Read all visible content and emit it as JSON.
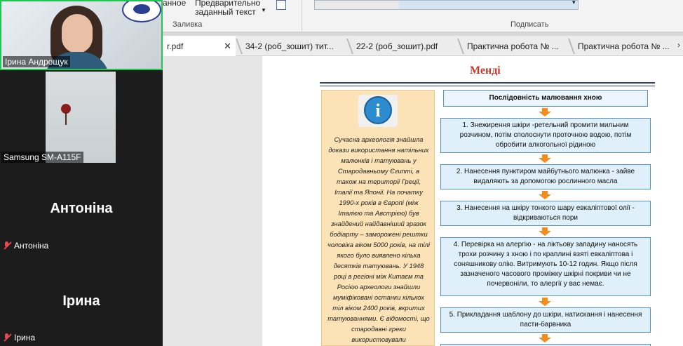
{
  "participants": {
    "tile1_name": "Ірина Андрощук",
    "tile2_name": "Samsung SM-A115F",
    "name3_big": "Антоніна",
    "name3_small": "Антоніна",
    "name4_big": "Ірина",
    "name4_small": "Ірина"
  },
  "ribbon": {
    "partial_label": "анное",
    "predef_line1": "Предварительно",
    "predef_line2": "заданный текст",
    "fill_group": "Заливка",
    "sign_group": "Подписать"
  },
  "tabs": [
    {
      "label": "r.pdf"
    },
    {
      "label": "34-2 (роб_зошит) тит..."
    },
    {
      "label": "22-2 (роб_зошит).pdf"
    },
    {
      "label": "Практична робота № ..."
    },
    {
      "label": "Практична робота № ..."
    }
  ],
  "document": {
    "title": "Менді",
    "info_text": "Сучасна археологія знайшла докази використання натільних малюнків і татуювань у Стародавньому Єгипті, а також на території Греції, Італії та Японії. На початку 1990-х років в Європі (між Італією та Австрією) був знайдений найдавніший зразок бодіарту – заморожені рештки чоловіка віком 5000 років, на тілі якого було виявлено кілька десятків татуювань. У 1948 році в регіоні між Китаєм та Росією археологи знайшли муміфіковані останки кількох тіл віком 2400 років, вкритих татуюваннями. Є відомості, що стародавні греки використовували",
    "flow_head": "Послідовність малювання хною",
    "steps": [
      "1. Знежирення шкіри -ретельний промити мильним розчином, потім сполоснути проточною водою, потім обробити алкогольної рідиною",
      "2. Нанесення пунктиром майбутнього малюнка - зайве видаляють за допомогою рослинного масла",
      "3. Нанесення на шкіру тонкого шару евкаліптової олії - відкриваються пори",
      "4. Перевірка на алергію - на ліктьову западину наносять трохи розчину з хною і по краплині взяті евкаліптова і соняшникову олію. Витримують 10-12 годин. Якщо після зазначеного часового проміжку шкірні покриви чи не почервоніли, то алергії у вас немає.",
      "5. Прикладання шаблону до шкіри, натискання і нанесення пасти-барвника"
    ]
  },
  "colors": {
    "active_speaker": "#23c552",
    "title_red": "#c0392b",
    "arrow_orange": "#f28c1e",
    "info_bg": "#fbe3b7",
    "flow_bg": "#dff0fb"
  }
}
